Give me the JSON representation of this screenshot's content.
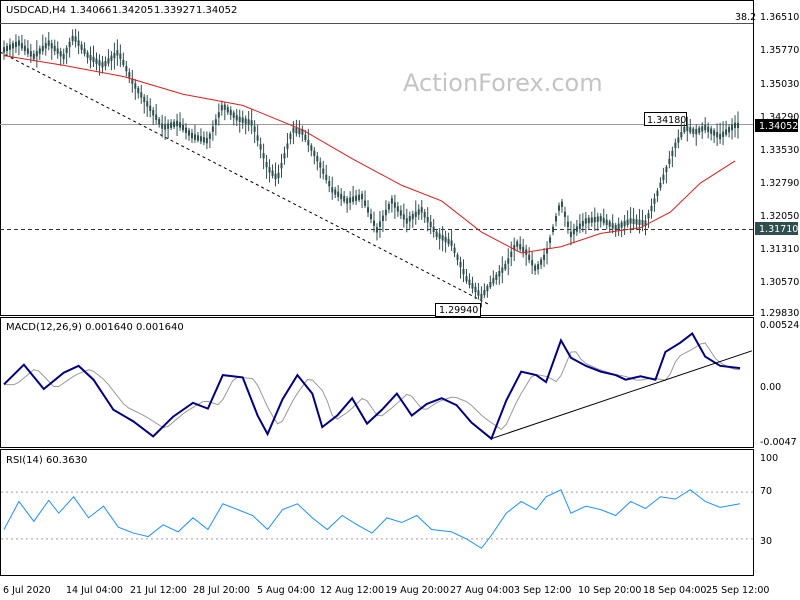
{
  "chart_data": [
    {
      "type": "candlestick-line",
      "title": "USDCAD,H4",
      "ohlc": [
        "1.34066",
        "1.34205",
        "1.33927",
        "1.34052"
      ],
      "watermark": "ActionForex.com",
      "ylim": [
        1.2983,
        1.3651
      ],
      "y_ticks": [
        "1.36510",
        "1.35770",
        "1.35030",
        "1.34290",
        "1.33530",
        "1.32790",
        "1.32050",
        "1.31310",
        "1.30570",
        "1.29830"
      ],
      "current_price_label": "1.34052",
      "fib_label": "38.2",
      "fib_level": 1.3625,
      "levels": [
        {
          "label": "1.34180",
          "value": 1.3418
        },
        {
          "label": "1.31710",
          "value": 1.3171
        },
        {
          "label": "1.29940",
          "value": 1.2994
        }
      ],
      "ma_line": [
        [
          0,
          1.3562
        ],
        [
          60,
          1.354
        ],
        [
          120,
          1.3515
        ],
        [
          180,
          1.3475
        ],
        [
          240,
          1.345
        ],
        [
          300,
          1.3395
        ],
        [
          350,
          1.333
        ],
        [
          400,
          1.327
        ],
        [
          440,
          1.3235
        ],
        [
          480,
          1.3165
        ],
        [
          520,
          1.3118
        ],
        [
          560,
          1.3132
        ],
        [
          600,
          1.3162
        ],
        [
          640,
          1.3175
        ],
        [
          670,
          1.321
        ],
        [
          700,
          1.3275
        ],
        [
          735,
          1.3325
        ]
      ],
      "price_path": [
        [
          0,
          1.3575
        ],
        [
          15,
          1.359
        ],
        [
          30,
          1.356
        ],
        [
          45,
          1.359
        ],
        [
          60,
          1.356
        ],
        [
          70,
          1.3605
        ],
        [
          85,
          1.356
        ],
        [
          100,
          1.354
        ],
        [
          115,
          1.357
        ],
        [
          130,
          1.35
        ],
        [
          145,
          1.345
        ],
        [
          160,
          1.34
        ],
        [
          175,
          1.341
        ],
        [
          190,
          1.338
        ],
        [
          205,
          1.337
        ],
        [
          220,
          1.345
        ],
        [
          235,
          1.342
        ],
        [
          250,
          1.341
        ],
        [
          265,
          1.331
        ],
        [
          275,
          1.3285
        ],
        [
          290,
          1.3395
        ],
        [
          300,
          1.339
        ],
        [
          315,
          1.333
        ],
        [
          330,
          1.326
        ],
        [
          345,
          1.3235
        ],
        [
          360,
          1.3245
        ],
        [
          375,
          1.317
        ],
        [
          390,
          1.3235
        ],
        [
          405,
          1.319
        ],
        [
          420,
          1.3215
        ],
        [
          435,
          1.316
        ],
        [
          450,
          1.314
        ],
        [
          465,
          1.306
        ],
        [
          480,
          1.302
        ],
        [
          490,
          1.305
        ],
        [
          505,
          1.309
        ],
        [
          515,
          1.314
        ],
        [
          525,
          1.312
        ],
        [
          535,
          1.308
        ],
        [
          545,
          1.3115
        ],
        [
          560,
          1.3235
        ],
        [
          570,
          1.316
        ],
        [
          585,
          1.319
        ],
        [
          600,
          1.3195
        ],
        [
          615,
          1.3175
        ],
        [
          630,
          1.319
        ],
        [
          645,
          1.3185
        ],
        [
          655,
          1.324
        ],
        [
          665,
          1.33
        ],
        [
          675,
          1.336
        ],
        [
          685,
          1.34
        ],
        [
          695,
          1.339
        ],
        [
          705,
          1.34
        ],
        [
          720,
          1.338
        ],
        [
          735,
          1.3405
        ]
      ]
    },
    {
      "type": "line",
      "title": "MACD(12,26,9) 0.001640 0.001640",
      "ylim": [
        -0.0047,
        0.005245
      ],
      "y_ticks": [
        "0.005245",
        "0.00",
        "-0.0047"
      ],
      "y_tick_values": [
        0.005245,
        0.0,
        -0.0047
      ],
      "macd_line": [
        [
          0,
          0.0002
        ],
        [
          20,
          0.0019
        ],
        [
          40,
          -0.0002
        ],
        [
          60,
          0.0012
        ],
        [
          75,
          0.0018
        ],
        [
          90,
          0.0006
        ],
        [
          110,
          -0.002
        ],
        [
          130,
          -0.003
        ],
        [
          150,
          -0.0043
        ],
        [
          170,
          -0.0026
        ],
        [
          190,
          -0.0014
        ],
        [
          205,
          -0.0019
        ],
        [
          220,
          0.001
        ],
        [
          240,
          0.0008
        ],
        [
          255,
          -0.0025
        ],
        [
          265,
          -0.0041
        ],
        [
          280,
          -0.0011
        ],
        [
          295,
          0.001
        ],
        [
          310,
          -0.0006
        ],
        [
          320,
          -0.0035
        ],
        [
          335,
          -0.0025
        ],
        [
          350,
          -0.001
        ],
        [
          365,
          -0.0032
        ],
        [
          380,
          -0.002
        ],
        [
          395,
          -0.0006
        ],
        [
          410,
          -0.0025
        ],
        [
          425,
          -0.0015
        ],
        [
          440,
          -0.001
        ],
        [
          455,
          -0.0016
        ],
        [
          470,
          -0.0031
        ],
        [
          490,
          -0.0045
        ],
        [
          505,
          -0.0012
        ],
        [
          520,
          0.0013
        ],
        [
          535,
          0.001
        ],
        [
          545,
          0.0004
        ],
        [
          560,
          0.004
        ],
        [
          570,
          0.0025
        ],
        [
          585,
          0.0018
        ],
        [
          600,
          0.0013
        ],
        [
          615,
          0.001
        ],
        [
          625,
          0.0006
        ],
        [
          640,
          0.0009
        ],
        [
          655,
          0.0006
        ],
        [
          665,
          0.003
        ],
        [
          680,
          0.0038
        ],
        [
          692,
          0.0046
        ],
        [
          705,
          0.0026
        ],
        [
          720,
          0.0018
        ],
        [
          740,
          0.0016
        ]
      ],
      "trend_line": [
        [
          490,
          -0.0045
        ],
        [
          752,
          0.0031
        ]
      ]
    },
    {
      "type": "line",
      "title": "RSI(14) 60.3630",
      "ylim": [
        0,
        100
      ],
      "y_ticks": [
        "100",
        "70",
        "30"
      ],
      "y_tick_values": [
        100,
        70,
        30
      ],
      "rsi": [
        [
          0,
          38
        ],
        [
          15,
          62
        ],
        [
          30,
          45
        ],
        [
          45,
          63
        ],
        [
          55,
          52
        ],
        [
          70,
          66
        ],
        [
          85,
          48
        ],
        [
          100,
          58
        ],
        [
          115,
          40
        ],
        [
          130,
          35
        ],
        [
          145,
          32
        ],
        [
          160,
          42
        ],
        [
          175,
          36
        ],
        [
          190,
          48
        ],
        [
          205,
          38
        ],
        [
          220,
          60
        ],
        [
          235,
          55
        ],
        [
          250,
          50
        ],
        [
          265,
          38
        ],
        [
          280,
          55
        ],
        [
          295,
          60
        ],
        [
          310,
          48
        ],
        [
          325,
          38
        ],
        [
          340,
          50
        ],
        [
          355,
          42
        ],
        [
          370,
          35
        ],
        [
          385,
          48
        ],
        [
          400,
          44
        ],
        [
          415,
          50
        ],
        [
          430,
          38
        ],
        [
          450,
          36
        ],
        [
          465,
          30
        ],
        [
          480,
          22
        ],
        [
          490,
          33
        ],
        [
          505,
          52
        ],
        [
          520,
          62
        ],
        [
          535,
          55
        ],
        [
          545,
          66
        ],
        [
          560,
          72
        ],
        [
          570,
          52
        ],
        [
          585,
          58
        ],
        [
          600,
          55
        ],
        [
          615,
          50
        ],
        [
          630,
          62
        ],
        [
          645,
          56
        ],
        [
          660,
          66
        ],
        [
          675,
          64
        ],
        [
          690,
          72
        ],
        [
          705,
          62
        ],
        [
          720,
          57
        ],
        [
          740,
          60
        ]
      ],
      "ref_lines": [
        70,
        30
      ]
    }
  ],
  "x_axis": {
    "labels": [
      "6 Jul 2020",
      "14 Jul 04:00",
      "21 Jul 12:00",
      "28 Jul 20:00",
      "5 Aug 04:00",
      "12 Aug 12:00",
      "19 Aug 20:00",
      "27 Aug 04:00",
      "3 Sep 12:00",
      "10 Sep 20:00",
      "18 Sep 04:00",
      "25 Sep 12:00"
    ]
  },
  "colors": {
    "price": "#2f4f4f",
    "ma": "#dc1e1e",
    "macd": "#000080",
    "signal": "#999999",
    "rsi": "#1e90ff",
    "grid": "#a0a0a0"
  }
}
